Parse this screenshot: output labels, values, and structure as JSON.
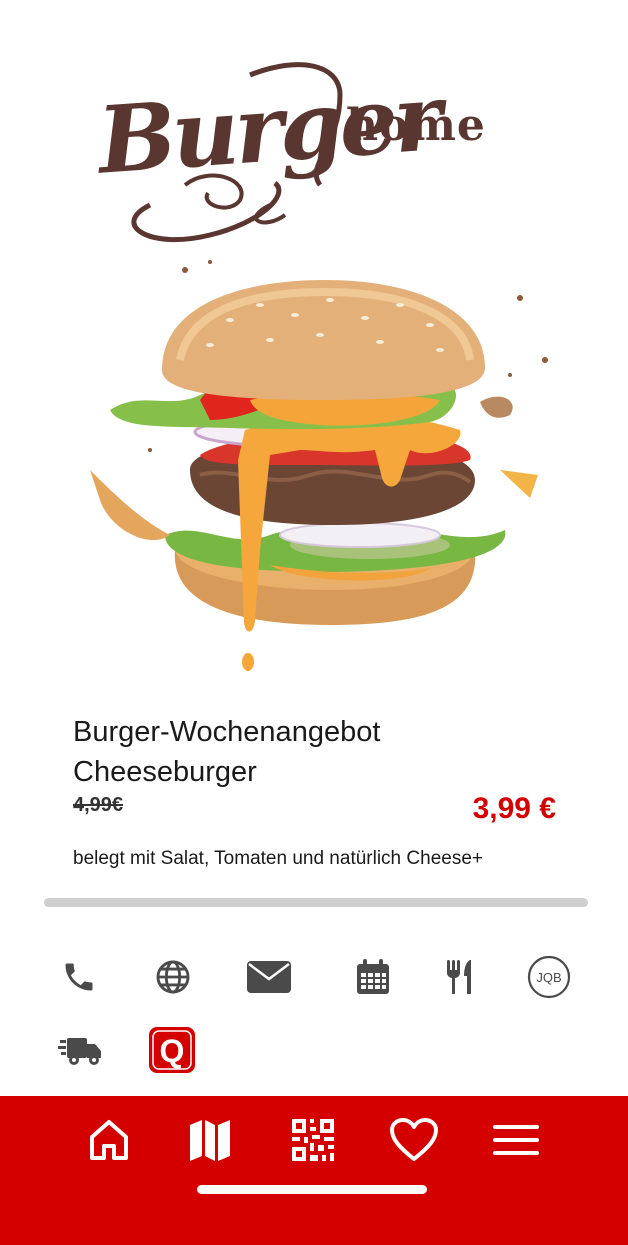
{
  "logo": {
    "script_text": "Burger",
    "word_text": "home",
    "color": "#5a3630"
  },
  "offer": {
    "title_line1": "Burger-Wochenangebot",
    "title_line2": "Cheeseburger",
    "old_price": "4,99€",
    "new_price": "3,99 €",
    "description": "belegt mit Salat, Tomaten und natürlich Cheese+"
  },
  "actions": [
    {
      "icon": "phone-icon"
    },
    {
      "icon": "globe-icon"
    },
    {
      "icon": "mail-icon"
    },
    {
      "icon": "calendar-icon"
    },
    {
      "icon": "cutlery-icon"
    },
    {
      "icon": "jqb-icon",
      "label": "JQB"
    },
    {
      "icon": "delivery-truck-icon"
    },
    {
      "icon": "q-app-icon",
      "label": "Q"
    }
  ],
  "nav": [
    {
      "icon": "home-icon"
    },
    {
      "icon": "map-icon"
    },
    {
      "icon": "qr-code-icon"
    },
    {
      "icon": "heart-icon"
    },
    {
      "icon": "menu-icon"
    }
  ],
  "colors": {
    "accent": "#d40000",
    "icon_gray": "#4a4a4a",
    "divider": "#cfcfcf"
  }
}
